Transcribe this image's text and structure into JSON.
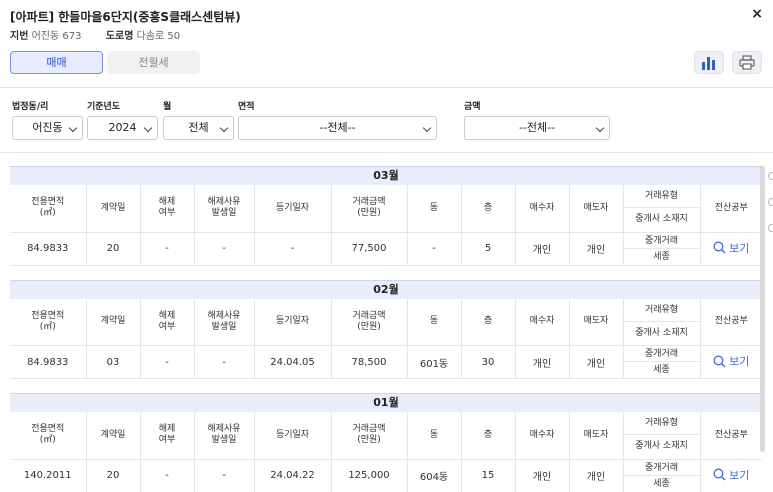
{
  "header": {
    "title": "[아파트] 한들마을6단지(중흥S클래스센텀뷰)",
    "jibun_label": "지번",
    "jibun_value": "어진동 673",
    "road_label": "도로명",
    "road_value": "다솜로 50",
    "close_symbol": "×"
  },
  "tabs": [
    {
      "label": "매매",
      "active": true
    },
    {
      "label": "전월세",
      "active": false
    }
  ],
  "toolbar": {
    "chart_icon": "bar-chart-icon",
    "print_icon": "printer-icon"
  },
  "filters": {
    "dong": {
      "label": "법정동/리",
      "value": "어진동"
    },
    "year": {
      "label": "기준년도",
      "value": "2024"
    },
    "month": {
      "label": "월",
      "value": "전체"
    },
    "area": {
      "label": "면적",
      "value": "--전체--"
    },
    "price": {
      "label": "금액",
      "value": "--전체--"
    }
  },
  "columns": {
    "area": "전용면적\n(㎡)",
    "contract_day": "계약일",
    "cancel": "해제\n여부",
    "cancel_reason": "해제사유\n발생일",
    "reg_date": "등기일자",
    "price": "거래금액\n(만원)",
    "dong": "동",
    "floor": "층",
    "buyer": "매수자",
    "seller": "매도자",
    "trade_type": "거래유형",
    "broker_loc": "중개사 소재지",
    "doc": "전산공부"
  },
  "sections": [
    {
      "month": "03월",
      "row": {
        "area": "84.9833",
        "contract_day": "20",
        "cancel": "-",
        "cancel_reason": "-",
        "reg_date": "-",
        "price": "77,500",
        "dong": "-",
        "floor": "5",
        "buyer": "개인",
        "seller": "개인",
        "trade_type": "중개거래",
        "broker_loc": "세종",
        "doc": "보기"
      }
    },
    {
      "month": "02월",
      "row": {
        "area": "84.9833",
        "contract_day": "03",
        "cancel": "-",
        "cancel_reason": "-",
        "reg_date": "24.04.05",
        "price": "78,500",
        "dong": "601동",
        "floor": "30",
        "buyer": "개인",
        "seller": "개인",
        "trade_type": "중개거래",
        "broker_loc": "세종",
        "doc": "보기"
      }
    },
    {
      "month": "01월",
      "row": {
        "area": "140.2011",
        "contract_day": "20",
        "cancel": "-",
        "cancel_reason": "-",
        "reg_date": "24.04.22",
        "price": "125,000",
        "dong": "604동",
        "floor": "15",
        "buyer": "개인",
        "seller": "개인",
        "trade_type": "중개거래",
        "broker_loc": "세종",
        "doc": "보기"
      }
    }
  ],
  "colors": {
    "accent": "#3450d6",
    "link": "#3a6ee0",
    "month_band": "#e9edfb"
  }
}
